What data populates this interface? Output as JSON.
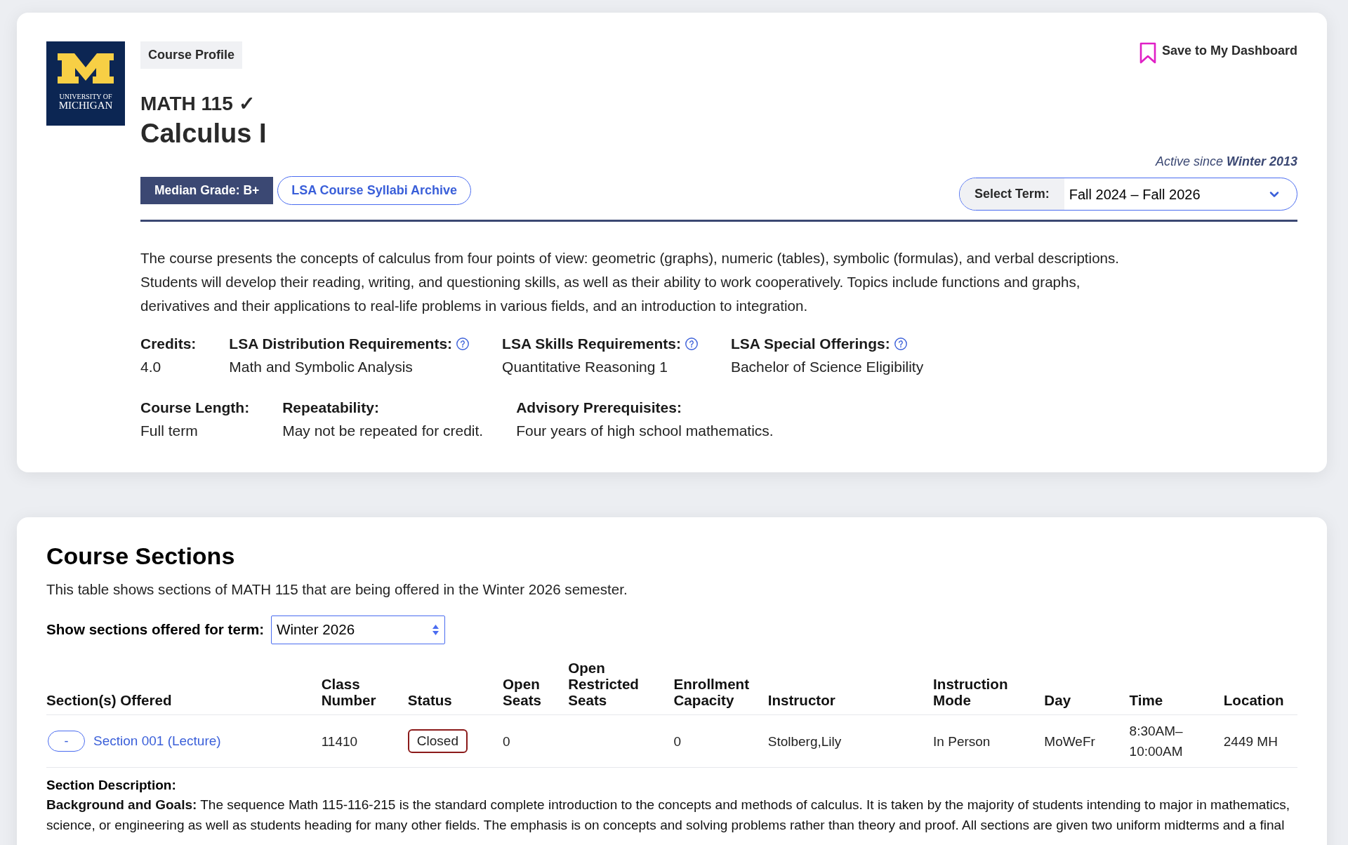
{
  "logo": {
    "wordmark": [
      "UNIVERSITY OF",
      "MICHIGAN"
    ]
  },
  "page_tag": "Course Profile",
  "save_link": "Save to My Dashboard",
  "course": {
    "code": "MATH 115 ✓",
    "title": "Calculus I"
  },
  "badges": [
    {
      "kind": "grade",
      "label": "Median Grade: B+"
    },
    {
      "kind": "link",
      "label": "LSA Course Syllabi Archive"
    }
  ],
  "active_since": "Active since **Winter 2013**",
  "term_select": {
    "label": "Select Term:",
    "value": "Fall 2024 – Fall 2026"
  },
  "description": "The course presents the concepts of calculus from four points of view: geometric (graphs), numeric (tables), symbolic (formulas), and verbal descriptions. Students will develop their reading, writing, and questioning skills, as well as their ability to work cooperatively. Topics include functions and graphs, derivatives and their applications to real-life problems in various fields, and an introduction to integration.",
  "attribute_rows": [
    {
      "items": [
        {
          "label": "Credits:",
          "value": "4.0",
          "help": false
        },
        {
          "label": "LSA Distribution Requirements:",
          "value": "Math and Symbolic Analysis",
          "help": true
        },
        {
          "label": "LSA Skills Requirements:",
          "value": "Quantitative Reasoning 1",
          "help": true
        },
        {
          "label": "LSA Special Offerings:",
          "value": "Bachelor of Science Eligibility",
          "help": true
        }
      ]
    },
    {
      "items": [
        {
          "label": "Course Length:",
          "value": "Full term",
          "help": false
        },
        {
          "label": "Repeatability:",
          "value": "May not be repeated for credit.",
          "help": false
        },
        {
          "label": "Advisory Prerequisites:",
          "value": "Four years of high school mathematics.",
          "help": false
        }
      ]
    }
  ],
  "sections": {
    "title": "Course Sections",
    "intro": "This table shows sections of MATH 115 that are being offered in the Winter 2026 semester.",
    "term_filter": {
      "label": "Show sections offered for term:",
      "value": "Winter 2026"
    },
    "table": {
      "columns": [
        "Section(s) Offered",
        "Class Number",
        "Status",
        "Open Seats",
        "Open Restricted Seats",
        "Enrollment Capacity",
        "Instructor",
        "Instruction Mode",
        "Day",
        "Time",
        "Location"
      ],
      "rows": [
        {
          "expanded": true,
          "toggle": "-",
          "section": "Section 001 (Lecture)",
          "class_number": "11410",
          "status": "Closed",
          "open_seats": "0",
          "enrollment_capacity": "0",
          "instructor": "Stolberg,Lily",
          "instruction_mode": "In Person",
          "day": "MoWeFr",
          "time": "8:30AM–10:00AM",
          "location": "2449 MH",
          "section_description": {
            "heading": "Section Description:",
            "text": "**Background and Goals:** The sequence Math 115-116-215 is the standard complete introduction to the concepts and methods of calculus. It is taken by the majority of students intending to major in mathematics, science, or engineering as well as students heading for many other fields. The emphasis is on concepts and solving problems rather than theory and proof. All sections are given two uniform midterms and a final"
          }
        }
      ]
    }
  }
}
